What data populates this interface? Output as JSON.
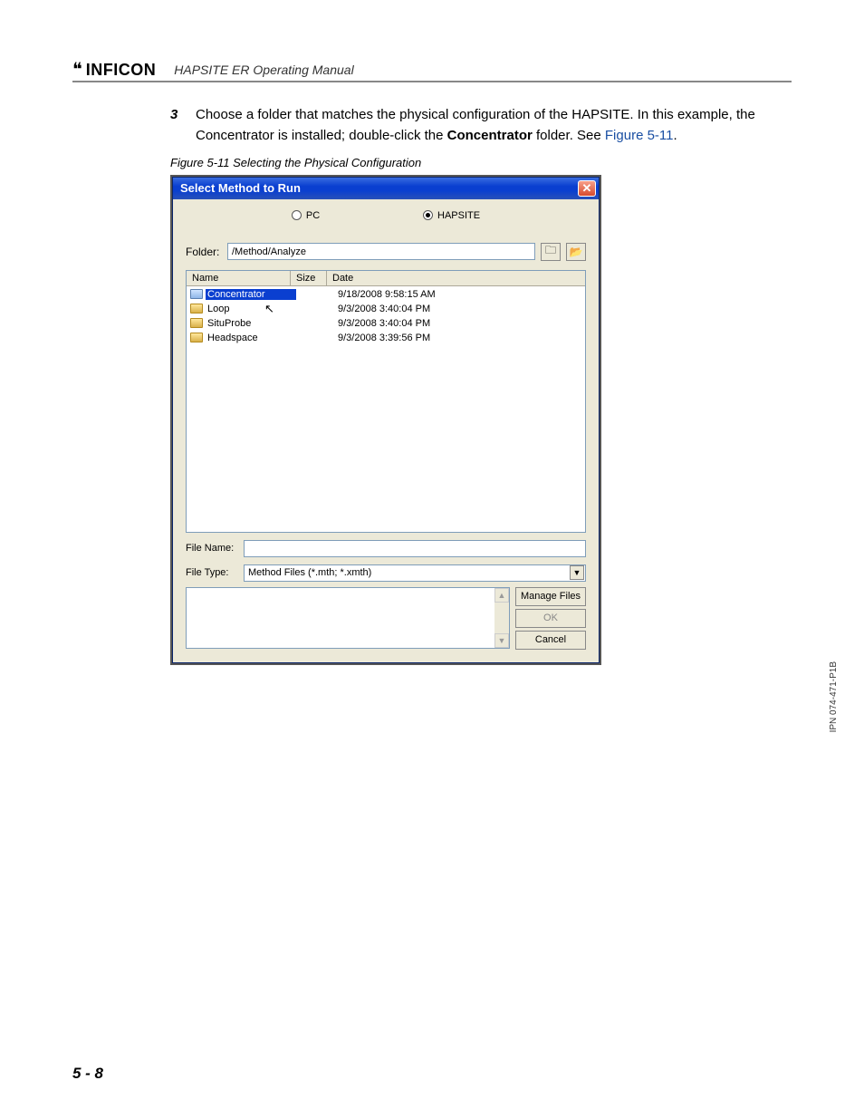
{
  "header": {
    "logo_text": "INFICON",
    "manual_title": "HAPSITE ER Operating Manual"
  },
  "step": {
    "number": "3",
    "text_pre": "Choose a folder that matches the physical configuration of the HAPSITE. In this example, the Concentrator is installed; double-click the ",
    "bold": "Concentrator",
    "text_post": " folder. See ",
    "fig_ref": "Figure 5-11",
    "period": "."
  },
  "figure_caption": "Figure 5-11  Selecting the Physical Configuration",
  "dialog": {
    "title": "Select Method to Run",
    "radios": {
      "pc": "PC",
      "hapsite": "HAPSITE"
    },
    "folder_label": "Folder:",
    "folder_value": "/Method/Analyze",
    "columns": {
      "name": "Name",
      "size": "Size",
      "date": "Date"
    },
    "rows": [
      {
        "name": "Concentrator",
        "date": "9/18/2008 9:58:15 AM",
        "selected": true
      },
      {
        "name": "Loop",
        "date": "9/3/2008 3:40:04 PM",
        "selected": false
      },
      {
        "name": "SituProbe",
        "date": "9/3/2008 3:40:04 PM",
        "selected": false
      },
      {
        "name": "Headspace",
        "date": "9/3/2008 3:39:56 PM",
        "selected": false
      }
    ],
    "file_name_label": "File Name:",
    "file_name_value": "",
    "file_type_label": "File Type:",
    "file_type_value": "Method Files (*.mth; *.xmth)",
    "buttons": {
      "manage": "Manage Files",
      "ok": "OK",
      "cancel": "Cancel"
    }
  },
  "footer": "5 - 8",
  "side_note": "IPN 074-471-P1B"
}
